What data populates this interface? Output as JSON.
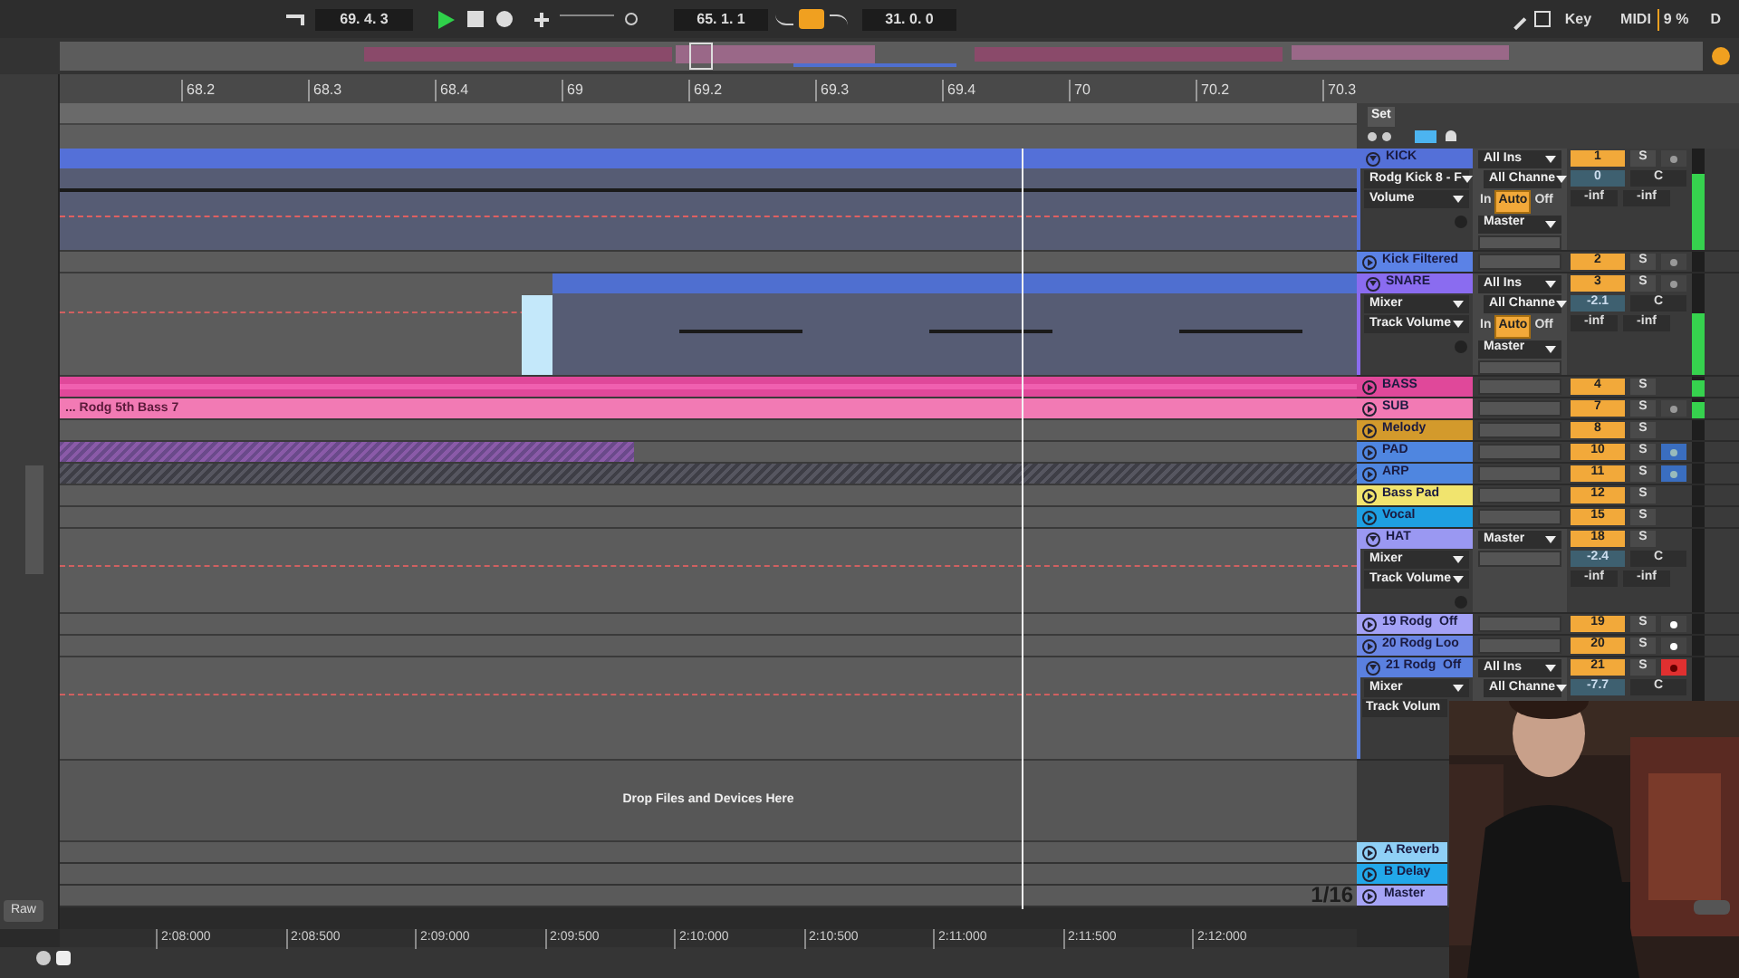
{
  "transport": {
    "arrangement_position": "69. 4. 3",
    "loop_start": "65. 1. 1",
    "loop_length": "31. 0. 0",
    "loop_on": true,
    "key": "Key",
    "midi": "MIDI",
    "cpu": "9 %",
    "disk": "D"
  },
  "ruler": {
    "bars": [
      "68.2",
      "68.3",
      "68.4",
      "69",
      "69.2",
      "69.3",
      "69.4",
      "70",
      "70.2",
      "70.3"
    ],
    "set_label": "Set"
  },
  "tracks": [
    {
      "name": "KICK",
      "color": "#5470d8",
      "expanded": true,
      "kind": "clip",
      "number": "1",
      "solo": "S",
      "arm": {
        "kind": "plain"
      },
      "meter": {
        "level": 0.75
      },
      "input": "All Ins",
      "channel": "All Channe",
      "device": "Rodg Kick 8 - F",
      "parameter": "Volume",
      "monitor": [
        {
          "label": "In",
          "selected": false
        },
        {
          "label": "Auto",
          "selected": true
        },
        {
          "label": "Off",
          "selected": false
        }
      ],
      "output": "Master",
      "volume": "0",
      "pan": "C",
      "sends": [
        "-inf",
        "-inf"
      ]
    },
    {
      "name": "Kick Filtered",
      "color": "#5b82e6",
      "expanded": false,
      "kind": "empty",
      "number": "2",
      "solo": "S",
      "arm": {
        "kind": "plain"
      }
    },
    {
      "name": "SNARE",
      "color": "#8a6cf0",
      "expanded": true,
      "kind": "partial",
      "number": "3",
      "solo": "S",
      "arm": {
        "kind": "plain"
      },
      "meter": {
        "level": 0.6
      },
      "input": "All Ins",
      "channel": "All Channe",
      "device": "Mixer",
      "parameter": "Track Volume",
      "monitor": [
        {
          "label": "In",
          "selected": false
        },
        {
          "label": "Auto",
          "selected": true
        },
        {
          "label": "Off",
          "selected": false
        }
      ],
      "output": "Master",
      "volume": "-2.1",
      "pan": "C",
      "sends": [
        "-inf",
        "-inf"
      ]
    },
    {
      "name": "BASS",
      "color": "#e0489a",
      "expanded": false,
      "kind": "clip",
      "number": "4",
      "solo": "S",
      "meter": {
        "level": 0.8
      }
    },
    {
      "name": "SUB",
      "color": "#f27ab4",
      "expanded": false,
      "kind": "clip",
      "clip_label": "... Rodg 5th Bass 7",
      "number": "7",
      "solo": "S",
      "arm": {
        "kind": "plain"
      },
      "meter": {
        "level": 0.8
      }
    },
    {
      "name": "Melody",
      "color": "#d39a2c",
      "expanded": false,
      "kind": "empty",
      "number": "8",
      "solo": "S"
    },
    {
      "name": "PAD",
      "color": "#4f86e0",
      "expanded": false,
      "kind": "hatched",
      "number": "10",
      "solo": "S",
      "arm": {
        "kind": "blue"
      }
    },
    {
      "name": "ARP",
      "color": "#4f86e0",
      "expanded": false,
      "kind": "dark",
      "number": "11",
      "solo": "S",
      "arm": {
        "kind": "blue"
      }
    },
    {
      "name": "Bass Pad",
      "color": "#f1e46e",
      "expanded": false,
      "kind": "empty",
      "number": "12",
      "solo": "S"
    },
    {
      "name": "Vocal",
      "color": "#1e9fe2",
      "expanded": false,
      "kind": "empty",
      "number": "15",
      "solo": "S"
    },
    {
      "name": "HAT",
      "color": "#9a98f2",
      "expanded": true,
      "kind": "empty",
      "number": "18",
      "solo": "S",
      "device": "Mixer",
      "parameter": "Track Volume",
      "output": "Master",
      "volume": "-2.4",
      "pan": "C",
      "sends": [
        "-inf",
        "-inf"
      ]
    },
    {
      "name": "19 Rodg  Off",
      "color": "#a3a1f6",
      "expanded": false,
      "kind": "empty",
      "number": "19",
      "solo": "S",
      "arm": {
        "kind": "white"
      }
    },
    {
      "name": "20 Rodg Loo",
      "color": "#6a86e4",
      "expanded": false,
      "kind": "empty",
      "number": "20",
      "solo": "S",
      "arm": {
        "kind": "white"
      }
    },
    {
      "name": "21 Rodg  Off",
      "color": "#5a80e0",
      "expanded": true,
      "kind": "empty",
      "number": "21",
      "solo": "S",
      "arm": {
        "kind": "red"
      },
      "input": "All Ins",
      "channel": "All Channe",
      "device": "Mixer",
      "parameter": "Track Volum",
      "volume": "-7.7",
      "pan": "C"
    }
  ],
  "drop_hint": "Drop Files and Devices Here",
  "returns": [
    {
      "name": "A Reverb",
      "color": "#8fd0f6"
    },
    {
      "name": "B Delay",
      "color": "#22a8ea"
    },
    {
      "name": "Master",
      "color": "#a6a4f6"
    }
  ],
  "grid": "1/16",
  "time_ruler": [
    "2:08:000",
    "2:08:500",
    "2:09:000",
    "2:09:500",
    "2:10:000",
    "2:10:500",
    "2:11:000",
    "2:11:500",
    "2:12:000"
  ],
  "raw_button": "Raw",
  "webcam": {
    "kind": "picture"
  }
}
